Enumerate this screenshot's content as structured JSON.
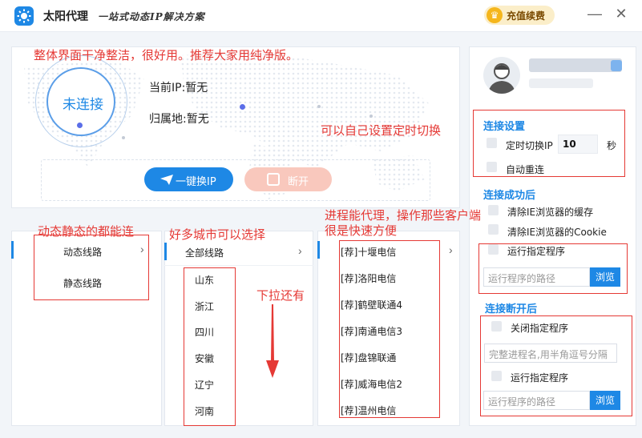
{
  "titlebar": {
    "app_title": "太阳代理",
    "slogan": "一站式动态IP解决方案",
    "recharge_label": "充值续费",
    "minimize_glyph": "—",
    "close_glyph": "✕"
  },
  "connection": {
    "status": "未连接",
    "current_ip": "当前IP:暂无",
    "location": "归属地:暂无",
    "switch_button": "一键换IP",
    "disconnect_button": "断开"
  },
  "line_types": {
    "items": [
      "动态线路",
      "静态线路"
    ]
  },
  "regions": {
    "all_label": "全部线路",
    "provinces": [
      "山东",
      "浙江",
      "四川",
      "安徽",
      "辽宁",
      "河南"
    ]
  },
  "servers": {
    "items": [
      "[荐]十堰电信",
      "[荐]洛阳电信",
      "[荐]鹤壁联通4",
      "[荐]南通电信3",
      "[荐]盘锦联通",
      "[荐]威海电信2",
      "[荐]温州电信"
    ]
  },
  "settings": {
    "connect_title": "连接设置",
    "timed_switch_label": "定时切换IP",
    "timed_switch_value": "10",
    "timed_switch_unit": "秒",
    "auto_reconnect_label": "自动重连",
    "after_connect_title": "连接成功后",
    "clear_cache_label": "清除IE浏览器的缓存",
    "clear_cookie_label": "清除IE浏览器的Cookie",
    "run_program_label": "运行指定程序",
    "program_path_placeholder": "运行程序的路径",
    "browse_label": "浏览",
    "after_disconnect_title": "连接断开后",
    "close_program_label": "关闭指定程序",
    "process_name_placeholder": "完整进程名,用半角逗号分隔",
    "run_program2_label": "运行指定程序",
    "program_path2_placeholder": "运行程序的路径",
    "browse2_label": "浏览"
  },
  "annotations": {
    "clean_ui": "整体界面干净整洁，很好用。推荐大家用纯净版。",
    "timed_switch": "可以自己设置定时切换",
    "static_dynamic": "动态静态的都能连",
    "many_cities": "好多城市可以选择",
    "process_proxy_line1": "进程能代理，操作那些客户端",
    "process_proxy_line2": "很是快速方便",
    "scroll_more": "下拉还有"
  },
  "colors": {
    "accent": "#1e88e5",
    "annotation_red": "#e53935",
    "disconnect_pink": "#f9c8bd"
  }
}
